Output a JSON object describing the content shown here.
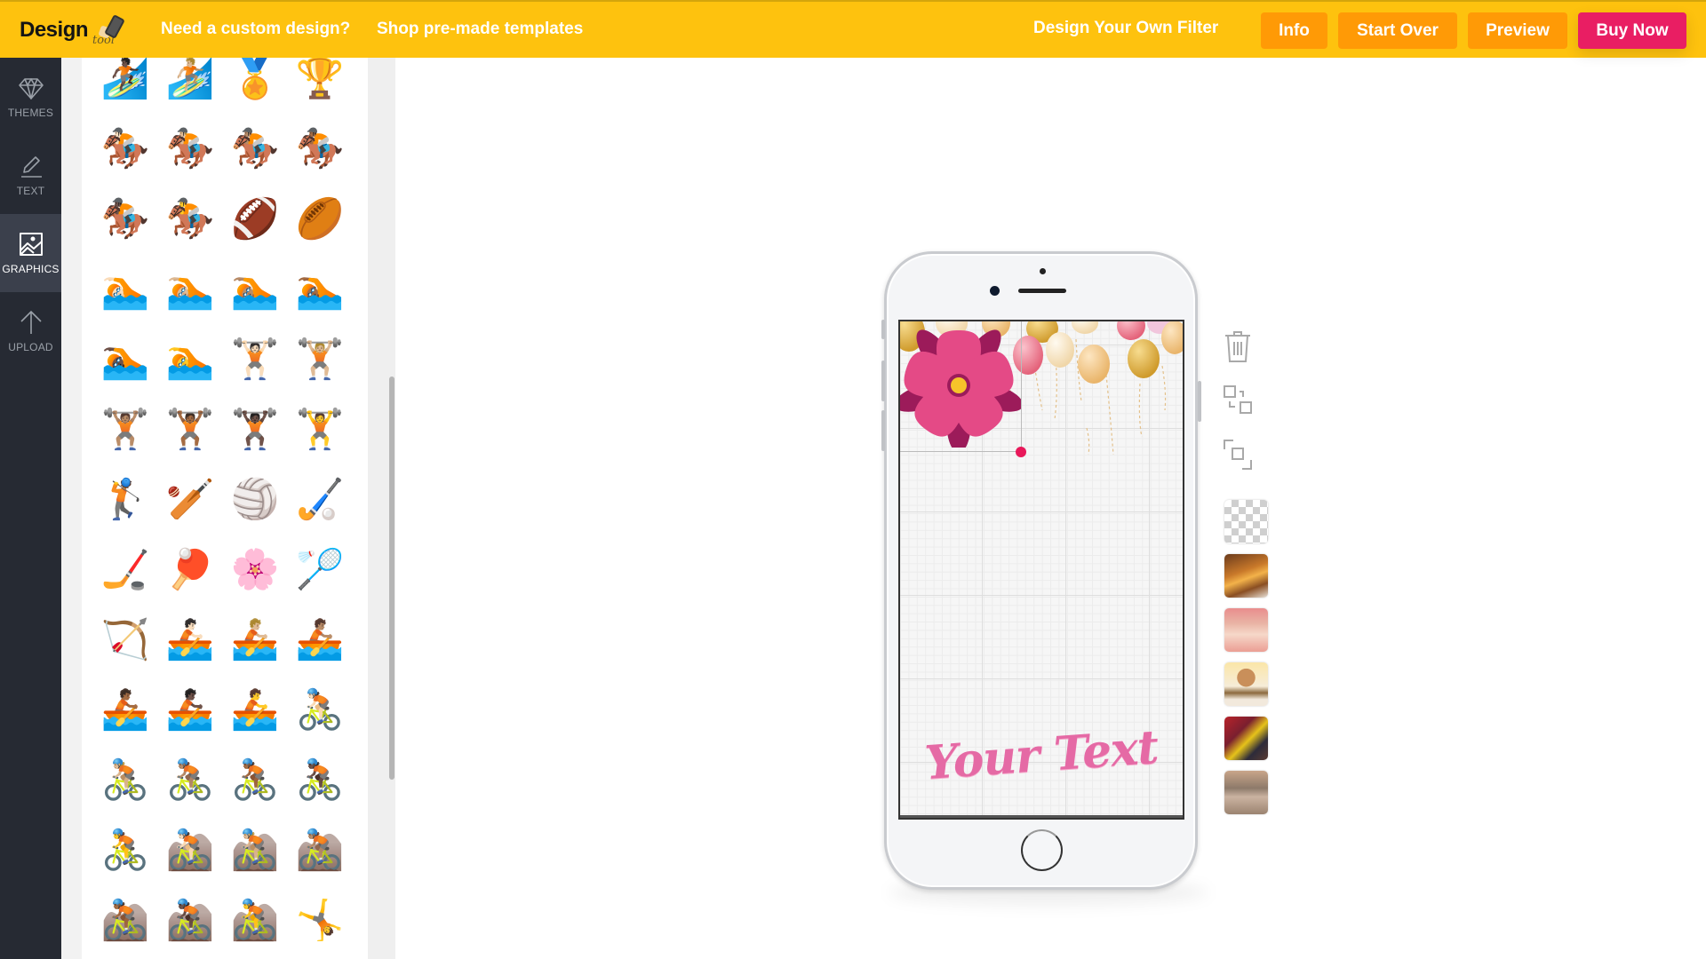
{
  "header": {
    "logo_main": "Design",
    "logo_sub": "tool",
    "links": [
      "Need a custom design?",
      "Shop pre-made templates"
    ],
    "subtitle": "Design Your Own Filter",
    "buttons": {
      "info": "Info",
      "start_over": "Start Over",
      "preview": "Preview",
      "buy_now": "Buy Now"
    }
  },
  "colors": {
    "header_bg": "#fec20e",
    "button_orange": "#ff9a06",
    "button_pink": "#e91e63",
    "sidebar_bg": "#262a33",
    "sidebar_active": "#3b404c",
    "text_pink": "#e56aa5"
  },
  "sidebar": {
    "items": [
      {
        "label": "THEMES",
        "icon": "diamond-icon"
      },
      {
        "label": "TEXT",
        "icon": "pencil-icon"
      },
      {
        "label": "GRAPHICS",
        "icon": "image-icon",
        "active": true
      },
      {
        "label": "UPLOAD",
        "icon": "upload-arrow-icon"
      }
    ]
  },
  "graphics_panel": {
    "rows": [
      [
        "🏄🏿",
        "🏄🏼",
        "🏅",
        "🏆"
      ],
      [
        "🏇🏻",
        "🏇🏼",
        "🏇🏽",
        "🏇🏾"
      ],
      [
        "🏇🏿",
        "🏇",
        "🏈",
        "🏉"
      ],
      [
        "🏊🏻",
        "🏊🏼",
        "🏊🏽",
        "🏊🏾"
      ],
      [
        "🏊🏿",
        "🏊",
        "🏋🏻",
        "🏋🏼"
      ],
      [
        "🏋🏽",
        "🏋🏾",
        "🏋🏿",
        "🏋"
      ],
      [
        "🏌",
        "🏏",
        "🏐",
        "🏑"
      ],
      [
        "🏒",
        "🏓",
        "🌸",
        "🏸"
      ],
      [
        "🏹",
        "🚣🏻",
        "🚣🏼",
        "🚣🏽"
      ],
      [
        "🚣🏾",
        "🚣🏿",
        "🚣",
        "🚴🏻"
      ],
      [
        "🚴🏼",
        "🚴🏽",
        "🚴🏾",
        "🚴🏿"
      ],
      [
        "🚴",
        "🚵🏻",
        "🚵🏼",
        "🚵🏽"
      ],
      [
        "🚵🏾",
        "🚵🏿",
        "🚵",
        "🤸"
      ]
    ]
  },
  "canvas": {
    "overlay_text": "Your Text",
    "graphics": [
      "pink-flower",
      "balloons"
    ]
  },
  "tools": [
    "delete",
    "ungroup",
    "group"
  ],
  "backgrounds": [
    "transparent",
    "party-table",
    "party-girls",
    "birthday-cake-girl",
    "dancing-party",
    "dance-floor-feet"
  ]
}
